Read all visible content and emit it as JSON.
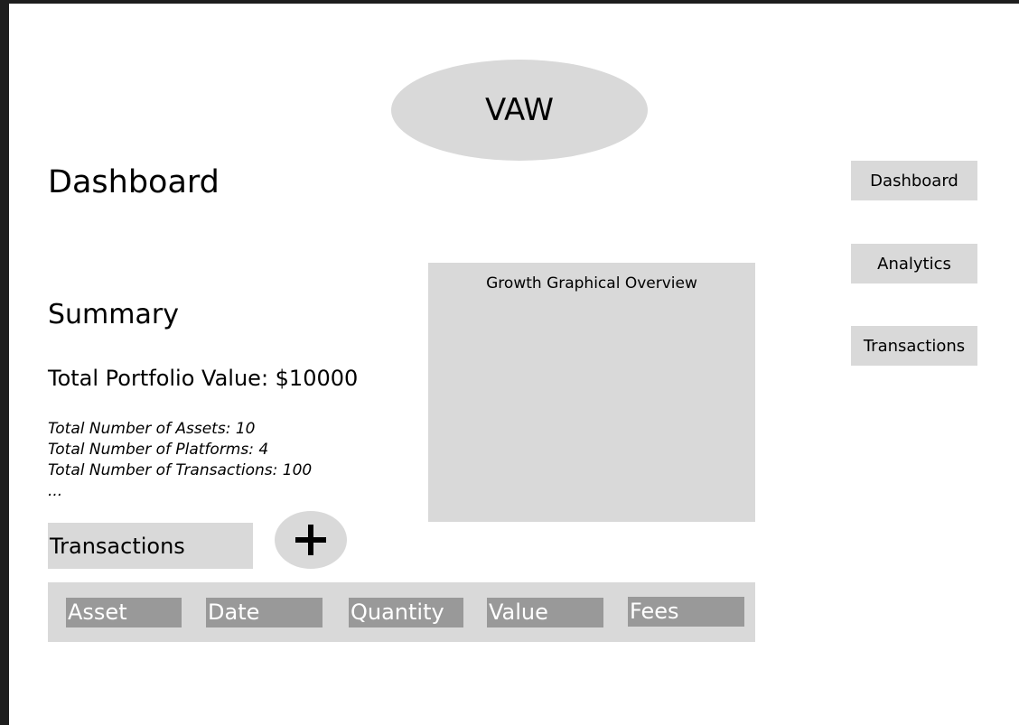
{
  "app": {
    "logo_text": "VAW"
  },
  "page": {
    "title": "Dashboard"
  },
  "summary": {
    "heading": "Summary",
    "portfolio_value": "Total Portfolio Value: $10000",
    "stats": [
      "Total Number of Assets: 10",
      "Total Number of Platforms: 4",
      "Total Number of Transactions: 100",
      "..."
    ]
  },
  "chart_panel": {
    "title": "Growth Graphical Overview"
  },
  "transactions": {
    "label": "Transactions",
    "add_icon": "plus-icon",
    "columns": [
      "Asset",
      "Date",
      "Quantity",
      "Value",
      "Fees"
    ]
  },
  "nav": {
    "items": [
      "Dashboard",
      "Analytics",
      "Transactions"
    ]
  },
  "colors": {
    "background": "#1e1e1e",
    "canvas": "#ffffff",
    "panel": "#d9d9d9",
    "column_header": "#999999",
    "column_text": "#ffffff"
  }
}
